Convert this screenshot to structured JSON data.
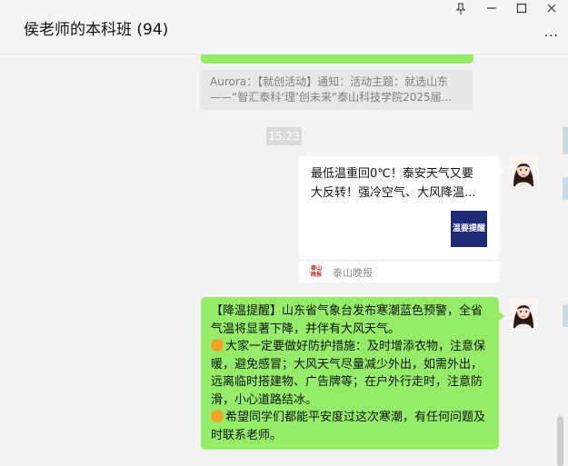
{
  "window": {
    "title": "侯老师的本科班 (94)",
    "pin_icon": "pin-icon",
    "minimize_icon": "minimize-icon",
    "maximize_icon": "maximize-icon",
    "close_icon": "close-icon",
    "more_label": "..."
  },
  "messages": {
    "quote": {
      "line1": "Aurora：【就创活动】通知：活动主题：就选山东",
      "line2": "——“智汇泰科‘理’创未来”泰山科技学院2025届..."
    },
    "time": "15:23",
    "card": {
      "title_line1": "最低温重回0℃！泰安天气又要",
      "title_line2": "大反转！强冷空气、大风降温...",
      "thumb_text": "温要提醒",
      "source_icon_text": "泰山晚报",
      "source": "泰山晚报"
    },
    "bubble": {
      "para1": "【降温提醒】山东省气象台发布寒潮蓝色预警，全省气温将显著下降，并伴有大风天气。",
      "para2": "大家一定要做好防护措施：及时增添衣物，注意保暖，避免感冒；大风天气尽量减少外出，如需外出，远离临时搭建物、广告牌等；在户外行走时，注意防滑，小心道路结冰。",
      "para3": "希望同学们都能平安度过这次寒潮，有任何问题及时联系老师。"
    }
  },
  "colors": {
    "self_bubble": "#95ec69",
    "background": "#f3f3f3",
    "card_thumb": "#1c2a78"
  }
}
